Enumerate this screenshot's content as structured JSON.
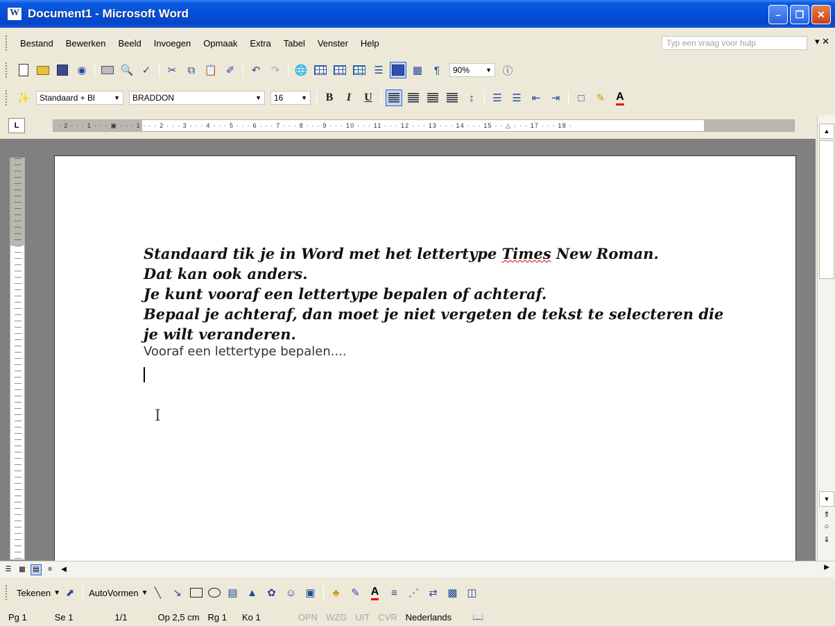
{
  "window": {
    "title": "Document1 - Microsoft Word"
  },
  "menu": {
    "items": [
      "Bestand",
      "Bewerken",
      "Beeld",
      "Invoegen",
      "Opmaak",
      "Extra",
      "Tabel",
      "Venster",
      "Help"
    ],
    "help_placeholder": "Typ een vraag voor hulp"
  },
  "format": {
    "style": "Standaard + Bl",
    "font": "BRADDON",
    "size": "16"
  },
  "standard": {
    "zoom": "90%"
  },
  "document": {
    "lines": [
      "Standaard tik je in Word met het lettertype ",
      "Times",
      " New Roman.",
      "Dat kan ook anders.",
      "Je kunt vooraf een lettertype bepalen of achteraf.",
      "Bepaal je achteraf, dan moet je niet vergeten de tekst te selecteren die",
      "je wilt veranderen.",
      "Vooraf een lettertype bepalen...."
    ]
  },
  "drawing": {
    "draw_label": "Tekenen",
    "autoshapes_label": "AutoVormen"
  },
  "status": {
    "page": "Pg 1",
    "section": "Se 1",
    "pages": "1/1",
    "at": "Op 2,5 cm",
    "line": "Rg 1",
    "column": "Ko 1",
    "rec": "OPN",
    "trk": "WZG",
    "ext": "UIT",
    "ovr": "CVR",
    "language": "Nederlands"
  }
}
